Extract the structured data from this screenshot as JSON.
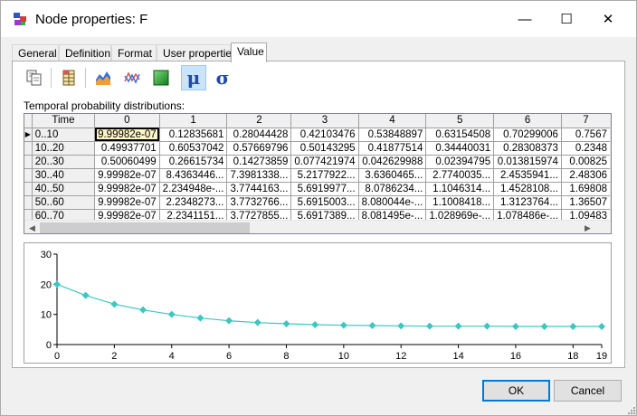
{
  "window": {
    "title": "Node properties: F",
    "minimize_glyph": "—",
    "maximize_glyph": "☐",
    "close_glyph": "✕"
  },
  "tabs": [
    {
      "label": "General",
      "active": false
    },
    {
      "label": "Definition",
      "active": false
    },
    {
      "label": "Format",
      "active": false
    },
    {
      "label": "User properties",
      "active": false
    },
    {
      "label": "Value",
      "active": true
    }
  ],
  "toolbar": {
    "items": [
      {
        "icon": "copy-icon"
      },
      {
        "icon": "table-icon"
      },
      {
        "icon": "area-chart-icon"
      },
      {
        "icon": "line-chart-icon"
      },
      {
        "icon": "green-square-icon"
      },
      {
        "icon": "mu-icon",
        "glyph": "μ",
        "active": true
      },
      {
        "icon": "sigma-icon",
        "glyph": "σ"
      }
    ]
  },
  "table": {
    "label": "Temporal probability distributions:",
    "corner_header": "Time",
    "column_headers": [
      "0",
      "1",
      "2",
      "3",
      "4",
      "5",
      "6",
      "7"
    ],
    "rows": [
      {
        "label": "0..10",
        "current": true,
        "values": [
          "9.99982e-07",
          "0.12835681",
          "0.28044428",
          "0.42103476",
          "0.53848897",
          "0.63154508",
          "0.70299006",
          "0.7567"
        ]
      },
      {
        "label": "10..20",
        "values": [
          "0.49937701",
          "0.60537042",
          "0.57669796",
          "0.50143295",
          "0.41877514",
          "0.34440031",
          "0.28308373",
          "0.2348"
        ]
      },
      {
        "label": "20..30",
        "values": [
          "0.50060499",
          "0.26615734",
          "0.14273859",
          "0.077421974",
          "0.042629988",
          "0.02394795",
          "0.013815974",
          "0.00825"
        ]
      },
      {
        "label": "30..40",
        "values": [
          "9.99982e-07",
          "8.4363446...",
          "7.3981338...",
          "5.2177922...",
          "3.6360465...",
          "2.7740035...",
          "2.4535941...",
          "2.48306"
        ]
      },
      {
        "label": "40..50",
        "values": [
          "9.99982e-07",
          "2.234948e-...",
          "3.7744163...",
          "5.6919977...",
          "8.0786234...",
          "1.1046314...",
          "1.4528108...",
          "1.69808"
        ]
      },
      {
        "label": "50..60",
        "values": [
          "9.99982e-07",
          "2.2348273...",
          "3.7732766...",
          "5.6915003...",
          "8.080044e-...",
          "1.1008418...",
          "1.3123764...",
          "1.36507"
        ]
      },
      {
        "label": "60..70",
        "values": [
          "9.99982e-07",
          "2.2341151...",
          "3.7727855...",
          "5.6917389...",
          "8.081495e-...",
          "1.028969e-...",
          "1.078486e-...",
          "1.09483"
        ]
      }
    ]
  },
  "chart_data": {
    "type": "line",
    "title": "",
    "xlabel": "",
    "ylabel": "",
    "x": [
      0,
      1,
      2,
      3,
      4,
      5,
      6,
      7,
      8,
      9,
      10,
      11,
      12,
      13,
      14,
      15,
      16,
      17,
      18,
      19
    ],
    "series": [
      {
        "values": [
          20.0,
          16.3,
          13.4,
          11.5,
          10.0,
          8.8,
          7.9,
          7.3,
          6.9,
          6.6,
          6.4,
          6.3,
          6.2,
          6.1,
          6.1,
          6.1,
          6.0,
          6.0,
          6.0,
          6.0
        ],
        "color": "#3fc6c2"
      }
    ],
    "xlim": [
      0,
      19
    ],
    "ylim": [
      0,
      30
    ],
    "xticks": [
      "0",
      "2",
      "4",
      "6",
      "8",
      "10",
      "12",
      "14",
      "16",
      "18",
      "19"
    ],
    "yticks": [
      "0",
      "10",
      "20",
      "30"
    ],
    "grid": false,
    "legend": "none"
  },
  "buttons": {
    "ok": "OK",
    "cancel": "Cancel"
  },
  "colors": {
    "accent": "#0078d7",
    "series": "#3fc6c2",
    "selected_cell": "#fff8c5"
  }
}
